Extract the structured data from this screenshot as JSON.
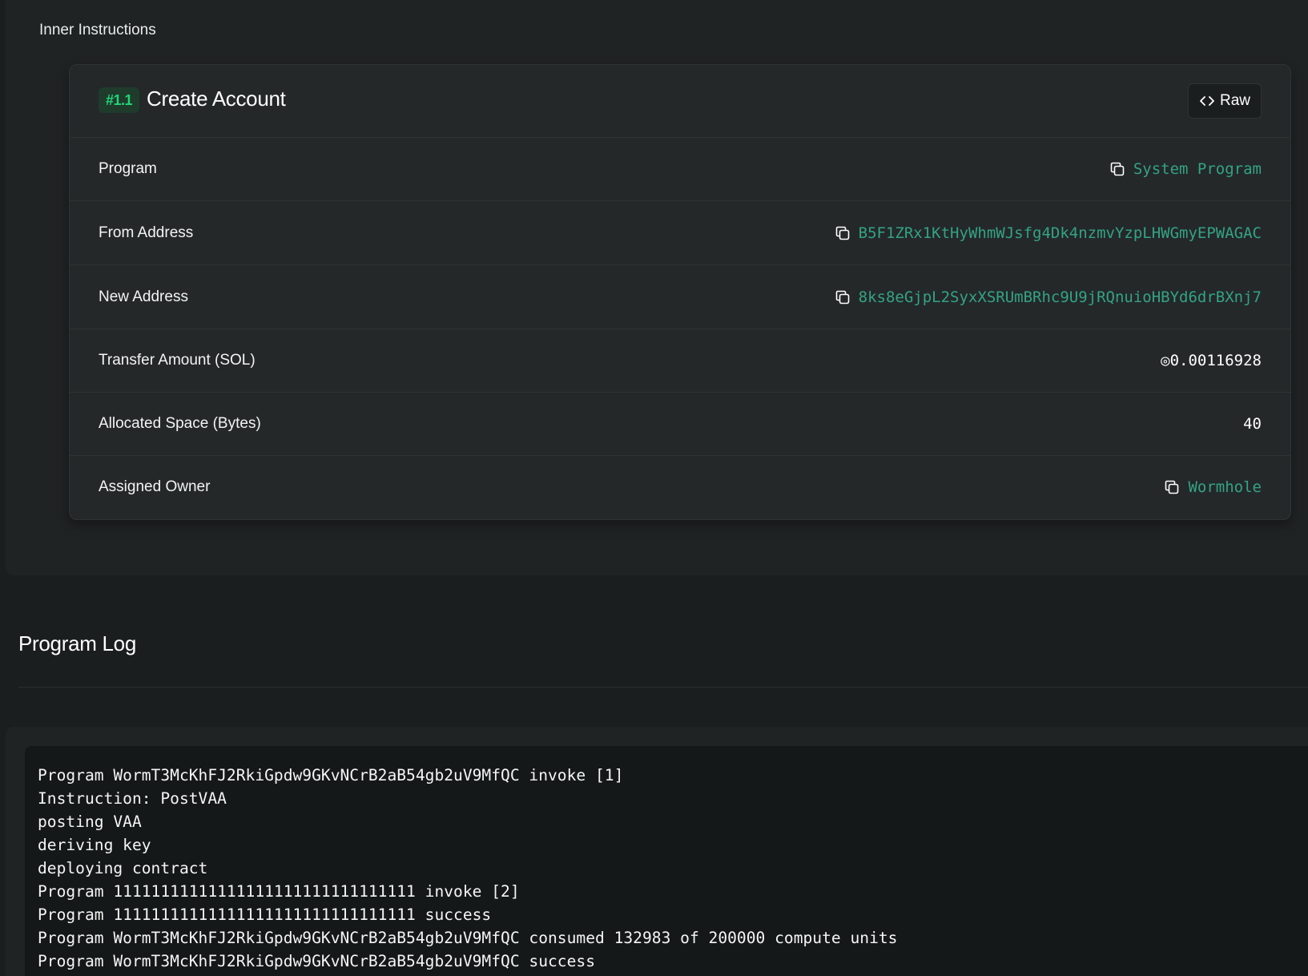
{
  "inner_instructions": {
    "title": "Inner Instructions",
    "instruction": {
      "badge": "#1.1",
      "name": "Create Account",
      "raw_button": "Raw",
      "rows": [
        {
          "label": "Program",
          "value": "System Program",
          "kind": "link",
          "icon": "copy-icon"
        },
        {
          "label": "From Address",
          "value": "B5F1ZRx1KtHyWhmWJsfg4Dk4nzmvYzpLHWGmyEPWAGAC",
          "kind": "link",
          "icon": "copy-icon"
        },
        {
          "label": "New Address",
          "value": "8ks8eGjpL2SyxXSRUmBRhc9U9jRQnuioHBYd6drBXnj7",
          "kind": "link",
          "icon": "copy-icon"
        },
        {
          "label": "Transfer Amount (SOL)",
          "value": "◎0.00116928",
          "kind": "plain"
        },
        {
          "label": "Allocated Space (Bytes)",
          "value": "40",
          "kind": "plain"
        },
        {
          "label": "Assigned Owner",
          "value": "Wormhole",
          "kind": "link",
          "icon": "copy-icon"
        }
      ]
    }
  },
  "program_log": {
    "title": "Program Log",
    "lines": [
      "Program WormT3McKhFJ2RkiGpdw9GKvNCrB2aB54gb2uV9MfQC invoke [1]",
      "Instruction: PostVAA",
      "posting VAA",
      "deriving key",
      "deploying contract",
      "Program 11111111111111111111111111111111 invoke [2]",
      "Program 11111111111111111111111111111111 success",
      "Program WormT3McKhFJ2RkiGpdw9GKvNCrB2aB54gb2uV9MfQC consumed 132983 of 200000 compute units",
      "Program WormT3McKhFJ2RkiGpdw9GKvNCrB2aB54gb2uV9MfQC success"
    ]
  },
  "colors": {
    "background": "#1b1e1e",
    "panel": "#202323",
    "card": "#252828",
    "accent_link": "#33a382",
    "badge_text": "#23d377",
    "badge_bg": "#1e3b2c"
  }
}
